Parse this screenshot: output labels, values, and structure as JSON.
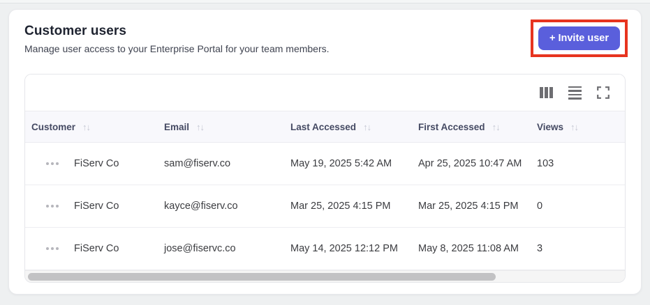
{
  "page": {
    "title": "Customer users",
    "subtitle": "Manage user access to your Enterprise Portal for your team members."
  },
  "header": {
    "invite_button_label": "+ Invite user"
  },
  "toolbar": {
    "icons": [
      "columns-icon",
      "density-icon",
      "fullscreen-icon"
    ]
  },
  "table": {
    "sort_icon": "↑↓",
    "columns": [
      {
        "label": "Customer"
      },
      {
        "label": "Email"
      },
      {
        "label": "Last Accessed"
      },
      {
        "label": "First Accessed"
      },
      {
        "label": "Views"
      }
    ],
    "rows": [
      {
        "customer": "FiServ Co",
        "email": "sam@fiserv.co",
        "last_accessed": "May 19, 2025 5:42 AM",
        "first_accessed": "Apr 25, 2025 10:47 AM",
        "views": "103"
      },
      {
        "customer": "FiServ Co",
        "email": "kayce@fiserv.co",
        "last_accessed": "Mar 25, 2025 4:15 PM",
        "first_accessed": "Mar 25, 2025 4:15 PM",
        "views": "0"
      },
      {
        "customer": "FiServ Co",
        "email": "jose@fiservc.co",
        "last_accessed": "May 14, 2025 12:12 PM",
        "first_accessed": "May 8, 2025 11:08 AM",
        "views": "3"
      }
    ]
  },
  "colors": {
    "accent": "#5a5fdc",
    "annotation_highlight": "#e7341f",
    "header_row_bg": "#f8f8fc"
  }
}
